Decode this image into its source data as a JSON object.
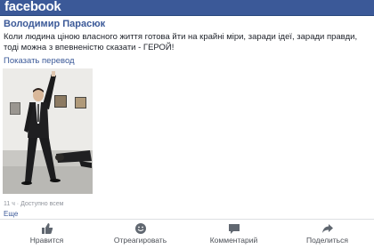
{
  "topbar": {
    "brand": "facebook"
  },
  "post": {
    "author": "Володимир Парасюк",
    "text": "Коли людина ціною власного життя готова йти на крайні міри, заради ідеї, заради правди, тоді можна з впевненістю сказати - ГЕРОЙ!",
    "translate_link": "Показать перевод",
    "meta": "11 ч · Доступно всем",
    "more_link": "Еще"
  },
  "actions": {
    "like": "Нравится",
    "react": "Отреагировать",
    "comment": "Комментарий",
    "share": "Поделиться"
  },
  "icons": {
    "like": "thumbs-up-icon",
    "react": "smiley-icon",
    "comment": "speech-bubble-icon",
    "share": "share-arrow-icon"
  },
  "colors": {
    "brand_blue": "#3b5998",
    "action_text": "#4b4f56",
    "meta_text": "#90949c"
  }
}
